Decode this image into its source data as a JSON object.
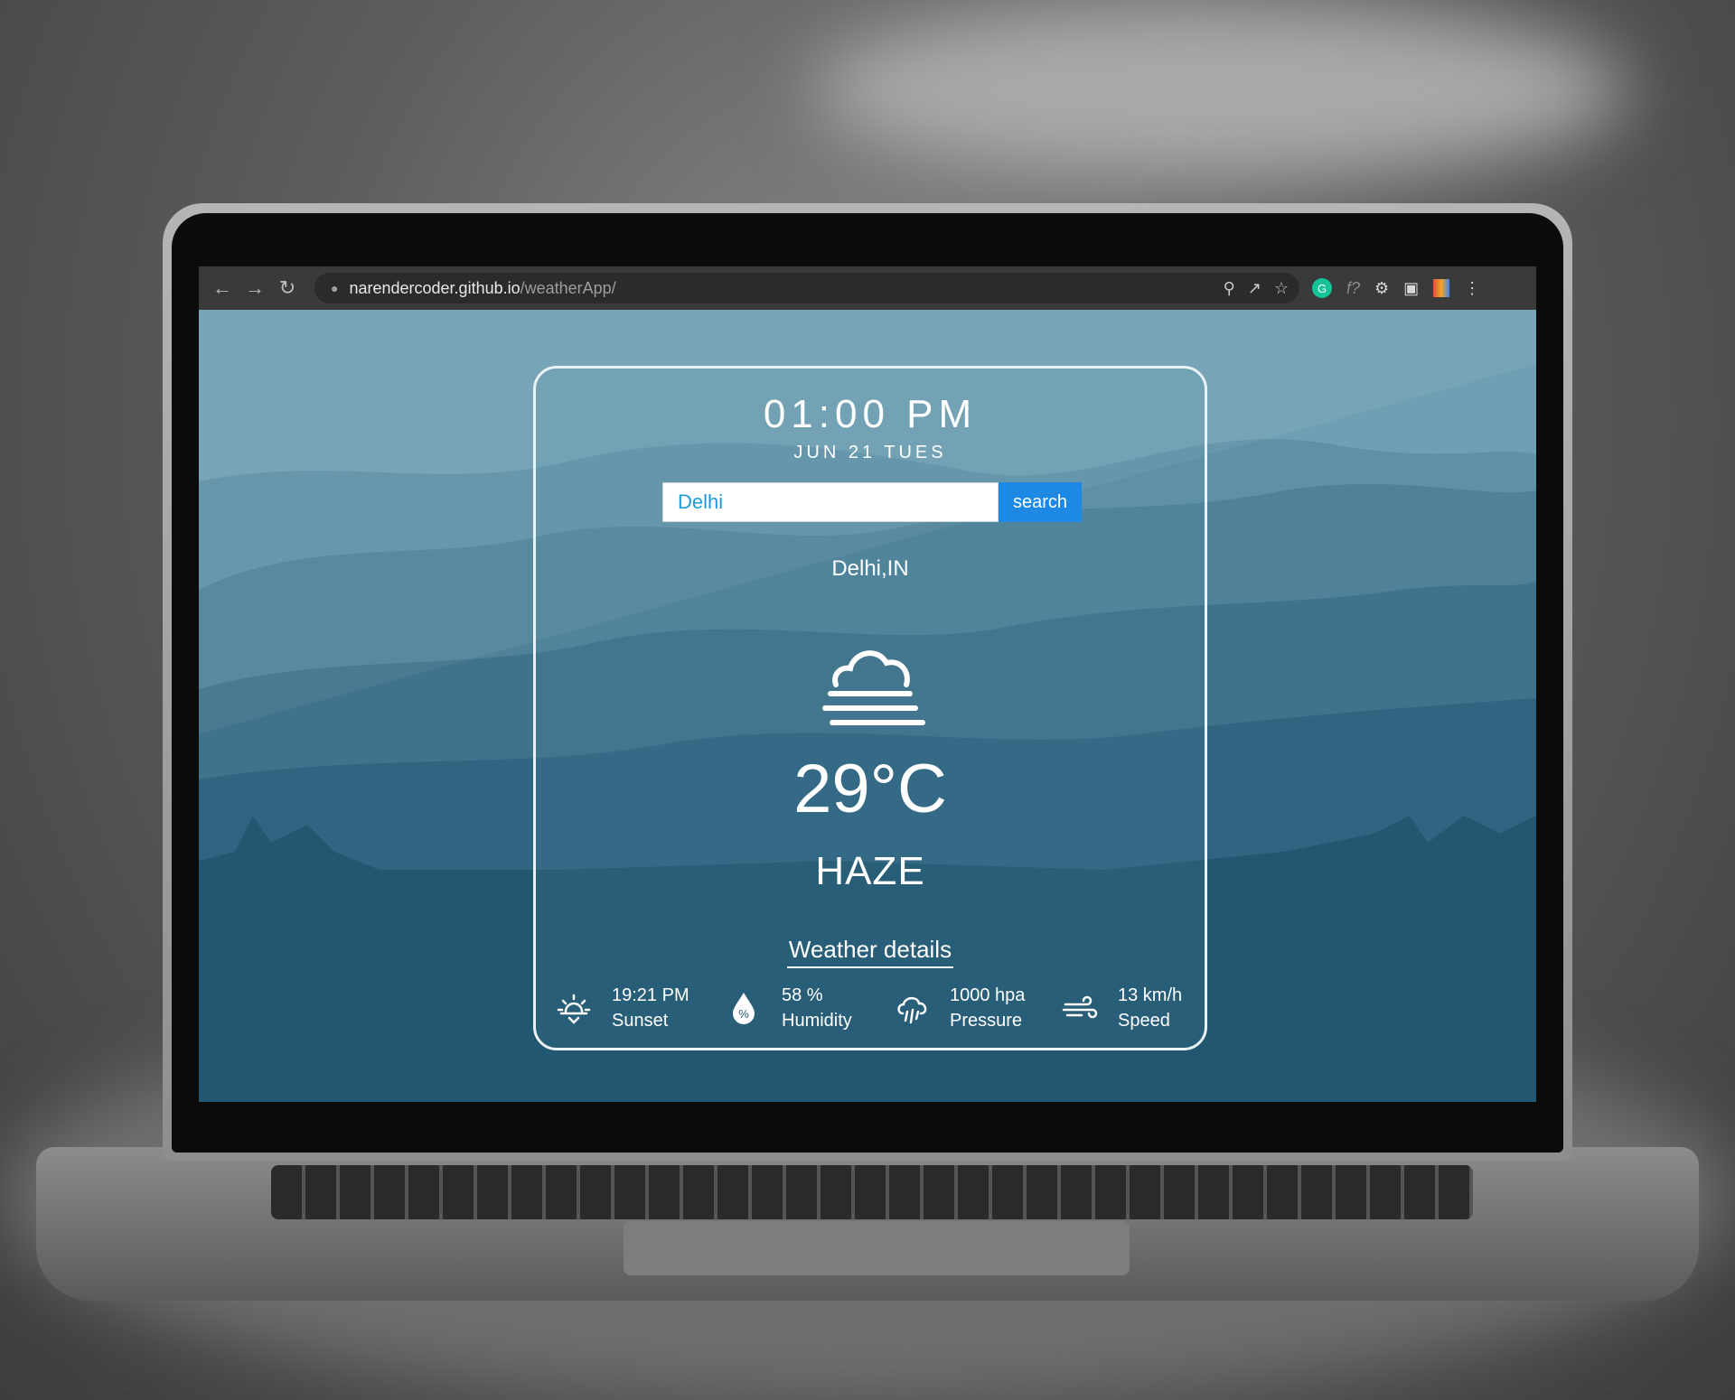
{
  "browser": {
    "url_host": "narendercoder.github.io",
    "url_path": "/weatherApp/"
  },
  "weather": {
    "time": "01:00 PM",
    "date": "JUN 21 TUES",
    "search": {
      "value": "Delhi",
      "button_label": "search"
    },
    "location": "Delhi,IN",
    "icon": "haze-icon",
    "temperature": "29°C",
    "condition": "HAZE",
    "details_title": "Weather details",
    "details": [
      {
        "icon": "sunset-icon",
        "value": "19:21 PM",
        "label": "Sunset"
      },
      {
        "icon": "humidity-icon",
        "value": "58 %",
        "label": "Humidity"
      },
      {
        "icon": "pressure-icon",
        "value": "1000 hpa",
        "label": "Pressure"
      },
      {
        "icon": "wind-icon",
        "value": "13 km/h",
        "label": "Speed"
      }
    ]
  },
  "colors": {
    "page_background": "#2a5e76",
    "search_button": "#1e88e5",
    "search_text": "#1e9ad6",
    "card_border": "#e9f2f5"
  }
}
